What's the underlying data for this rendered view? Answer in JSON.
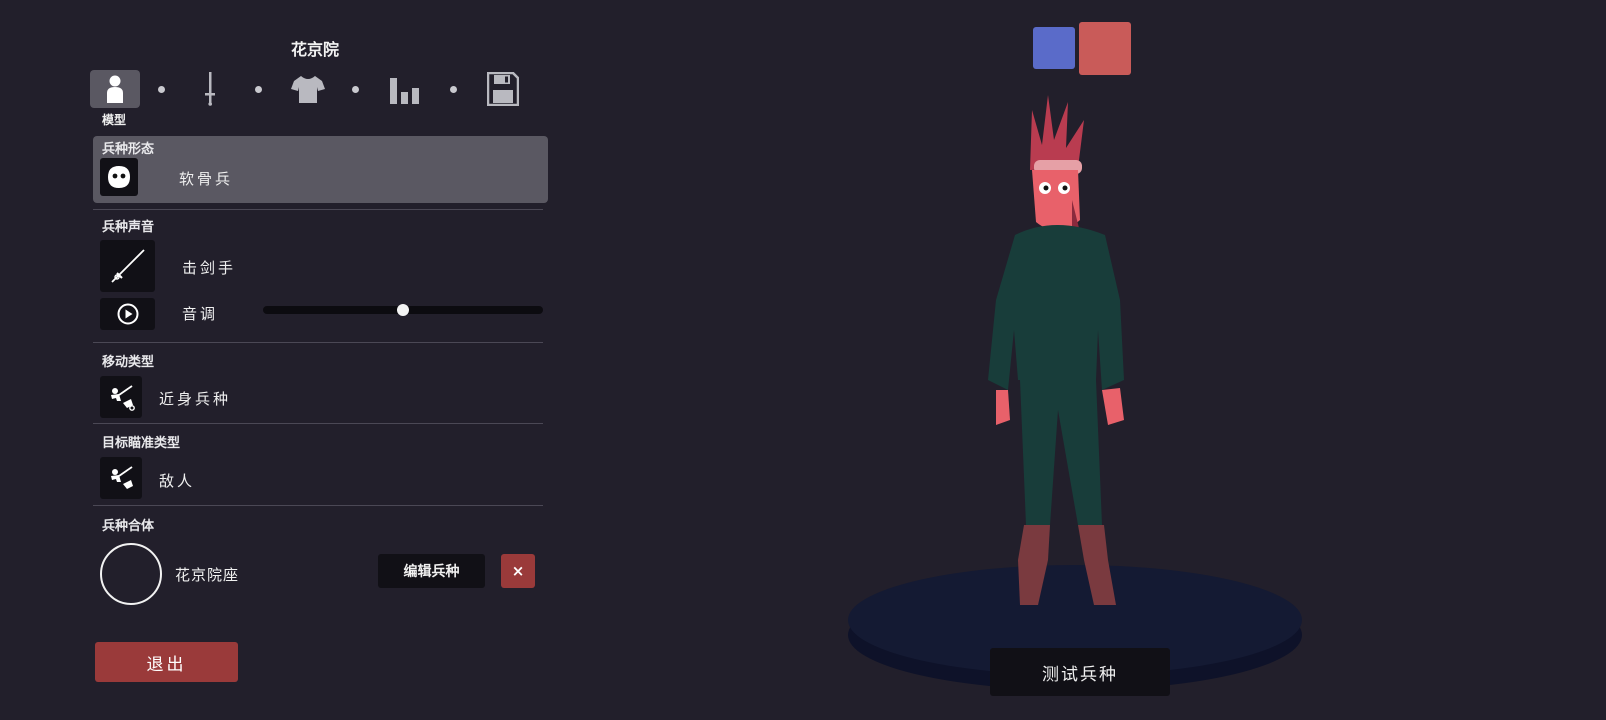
{
  "header": {
    "title": "花京院"
  },
  "tabs": [
    {
      "name": "model",
      "icon": "person-icon",
      "active": true
    },
    {
      "name": "weapon",
      "icon": "sword-icon",
      "active": false
    },
    {
      "name": "clothing",
      "icon": "shirt-icon",
      "active": false
    },
    {
      "name": "stats",
      "icon": "stats-icon",
      "active": false
    },
    {
      "name": "save",
      "icon": "save-icon",
      "active": false
    }
  ],
  "section_title": "模型",
  "unit_form": {
    "label": "兵种形态",
    "value": "软骨兵",
    "icon": "face-icon"
  },
  "unit_voice": {
    "label": "兵种声音",
    "value": "击剑手",
    "icon": "rapier-icon",
    "pitch_label": "音调",
    "pitch_value": 0.5,
    "play_icon": "play-icon"
  },
  "movement": {
    "label": "移动类型",
    "value": "近身兵种",
    "icon": "melee-icon"
  },
  "targeting": {
    "label": "目标瞄准类型",
    "value": "敌人",
    "icon": "target-enemy-icon"
  },
  "merge": {
    "label": "兵种合体",
    "value": "花京院座",
    "edit_button": "编辑兵种",
    "remove_button": "×"
  },
  "exit_button": "退出",
  "team_colors": [
    {
      "name": "blue-team",
      "color": "#5a6bc9",
      "selected": false
    },
    {
      "name": "red-team",
      "color": "#c95b59",
      "selected": true
    }
  ],
  "test_button": "测试兵种",
  "colors": {
    "background": "#221f2b",
    "panel_highlight": "#5a5862",
    "accent_red": "#9a3a3a",
    "platform": "#141a33"
  }
}
